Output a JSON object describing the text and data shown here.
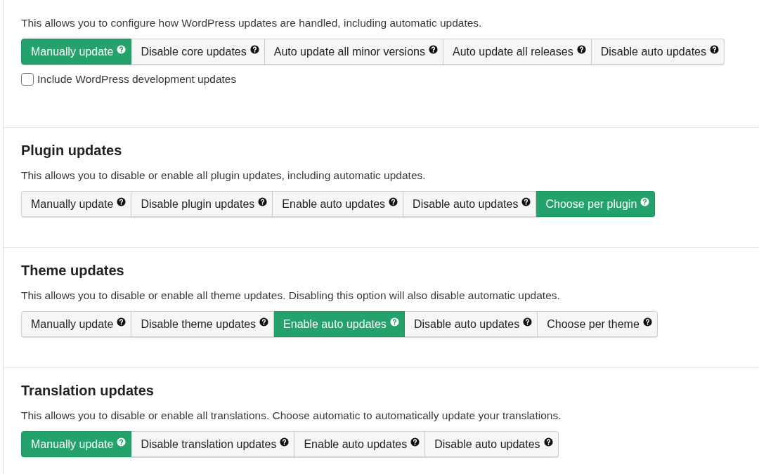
{
  "sections": [
    {
      "description": "This allows you to configure how WordPress updates are handled, including automatic updates.",
      "options": [
        {
          "label": "Manually update",
          "selected": true
        },
        {
          "label": "Disable core updates",
          "selected": false
        },
        {
          "label": "Auto update all minor versions",
          "selected": false
        },
        {
          "label": "Auto update all releases",
          "selected": false
        },
        {
          "label": "Disable auto updates",
          "selected": false
        }
      ],
      "checkbox": {
        "label": "Include WordPress development updates",
        "checked": false
      }
    },
    {
      "title": "Plugin updates",
      "description": "This allows you to disable or enable all plugin updates, including automatic updates.",
      "options": [
        {
          "label": "Manually update",
          "selected": false
        },
        {
          "label": "Disable plugin updates",
          "selected": false
        },
        {
          "label": "Enable auto updates",
          "selected": false
        },
        {
          "label": "Disable auto updates",
          "selected": false
        },
        {
          "label": "Choose per plugin",
          "selected": true
        }
      ]
    },
    {
      "title": "Theme updates",
      "description": "This allows you to disable or enable all theme updates. Disabling this option will also disable automatic updates.",
      "options": [
        {
          "label": "Manually update",
          "selected": false
        },
        {
          "label": "Disable theme updates",
          "selected": false
        },
        {
          "label": "Enable auto updates",
          "selected": true
        },
        {
          "label": "Disable auto updates",
          "selected": false
        },
        {
          "label": "Choose per theme",
          "selected": false
        }
      ]
    },
    {
      "title": "Translation updates",
      "description": "This allows you to disable or enable all translations. Choose automatic to automatically update your translations.",
      "options": [
        {
          "label": "Manually update",
          "selected": true
        },
        {
          "label": "Disable translation updates",
          "selected": false
        },
        {
          "label": "Enable auto updates",
          "selected": false
        },
        {
          "label": "Disable auto updates",
          "selected": false
        }
      ]
    }
  ]
}
